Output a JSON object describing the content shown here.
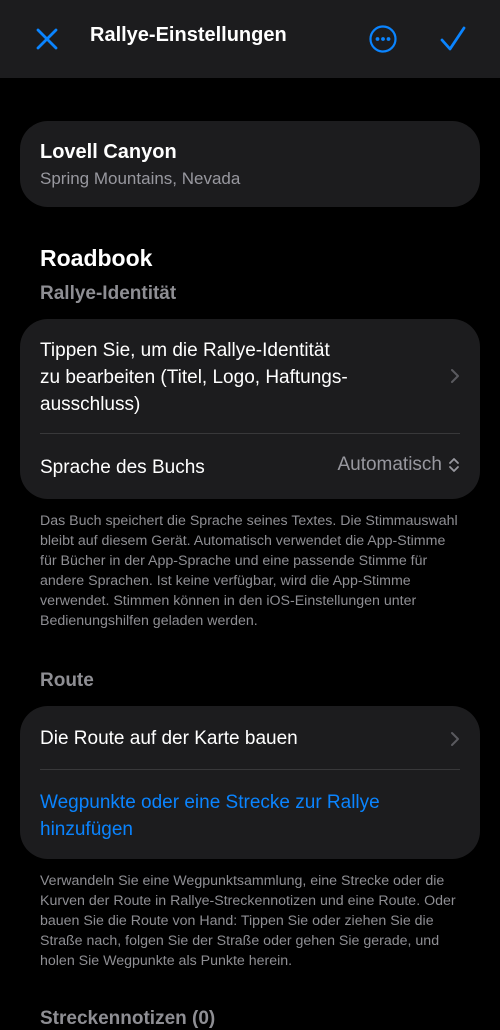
{
  "navbar": {
    "title": "Rallye-Einstellungen",
    "accent_color": "#0a84ff"
  },
  "location": {
    "name": "Lovell Canyon",
    "region": "Spring Mountains, Nevada"
  },
  "roadbook": {
    "heading": "Roadbook",
    "subheading": "Rallye-Identität",
    "identity_row_line1": "Tippen Sie, um die Rallye-Identität",
    "identity_row_line2": "zu bearbeiten (Titel, Logo, Haftungs-",
    "identity_row_line3": "ausschluss)",
    "language_label": "Sprache des Buchs",
    "language_value": "Automatisch",
    "note": "Das Buch speichert die Sprache seines Textes. Die Stimmauswahl bleibt auf diesem Gerät. Automatisch verwendet die App-Stimme für Bücher in der App-Sprache und eine passende Stimme für andere Sprachen. Ist keine verfügbar, wird die App-Stimme verwendet. Stimmen können in den iOS-Einstellungen unter Bedienungshilfen geladen werden."
  },
  "route": {
    "heading": "Route",
    "build_label": "Die Route auf der Karte bauen",
    "add_line1": "Wegpunkte oder eine Strecke zur Rallye",
    "add_line2": "hinzufügen",
    "note": "Verwandeln Sie eine Wegpunktsammlung, eine Strecke oder die Kurven der Route in Rallye-Streckennotizen und eine Route. Oder bauen Sie die Route von Hand: Tippen Sie oder ziehen Sie die Straße nach, folgen Sie der Straße oder gehen Sie gerade, und holen Sie Wegpunkte als Punkte herein."
  },
  "next_section": {
    "heading": "Streckennotizen (0)"
  }
}
